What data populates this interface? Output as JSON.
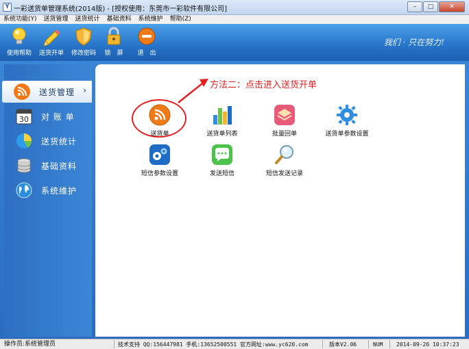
{
  "window": {
    "title": "一彩送货单管理系统(2014版) - [授权使用：东莞市一彩软件有限公司]",
    "min": "–",
    "max": "□",
    "close": "✕"
  },
  "menu": [
    "系统功能(Y)",
    "送货管理",
    "送货统计",
    "基础资料",
    "系统维护",
    "帮助(Z)"
  ],
  "toolbar": {
    "items": [
      "使用帮助",
      "送货开单",
      "修改密码",
      "锁　屏",
      "退　出"
    ],
    "slogan": "我们 · 只在努力!"
  },
  "sidebar": {
    "items": [
      "送货管理",
      "对 账 单",
      "送货统计",
      "基础资料",
      "系统维护"
    ],
    "active_arrow": "›",
    "calendar_day": "30"
  },
  "content": {
    "tiles": [
      "送货单",
      "送货单列表",
      "批量回单",
      "送货单参数设置",
      "短信参数设置",
      "发送短信",
      "短信发送记录"
    ],
    "annotation": "方法二：点击进入送货开单"
  },
  "status": {
    "operator": "操作员:系统管理员",
    "support": "技术支持 QQ:156447981 手机:13652500551 官方网址:www.yc620.com",
    "version": "版本V2.06",
    "num": "NUM",
    "datetime": "2014-09-26 10:37:23"
  },
  "colors": {
    "toolbar": "#2773c8",
    "sidebar": "#2d6fc2",
    "annotation": "#e02020"
  },
  "icons": {
    "toolbar": [
      "lightbulb-icon",
      "pencil-icon",
      "shield-icon",
      "padlock-icon",
      "exit-icon"
    ],
    "sidebar": [
      "rss-icon",
      "calendar-icon",
      "pie-chart-icon",
      "database-icon",
      "globe-icon"
    ],
    "tiles": [
      "rss-icon",
      "bar-chart-icon",
      "stack-icon",
      "gear-icon",
      "gears-icon",
      "chat-bubble-icon",
      "magnifier-icon"
    ]
  }
}
